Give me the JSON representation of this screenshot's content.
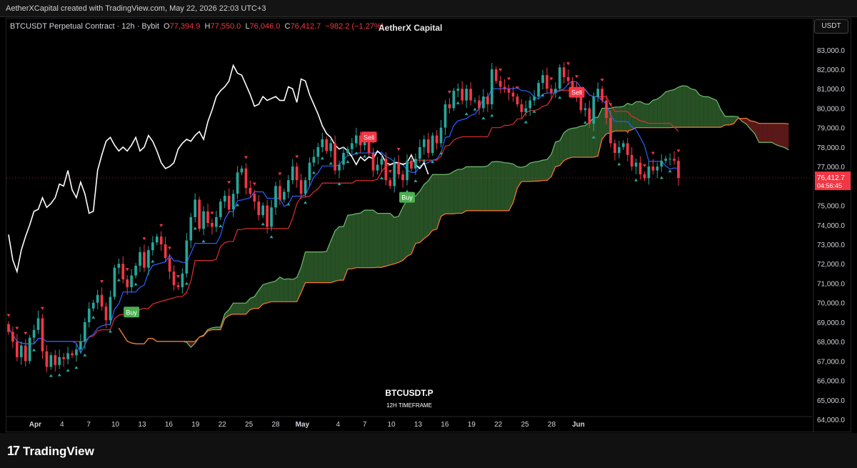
{
  "header": {
    "credit": "AetherXCapital created with TradingView.com, May 22, 2026 22:03 UTC+3"
  },
  "legend": {
    "symbol": "BTCUSDT Perpetual Contract · 12h · Bybit",
    "o_label": "O",
    "o_value": "77,394.9",
    "h_label": "H",
    "h_value": "77,550.0",
    "l_label": "L",
    "l_value": "76,046.0",
    "c_label": "C",
    "c_value": "76,412.7",
    "change": "−982.2 (−1.27%)"
  },
  "watermark_top": "AetherX Capital",
  "currency_button": "USDT",
  "footer_brand": "TradingView",
  "colors": {
    "up": "#26a69a",
    "down": "#f23645",
    "tenkan": "#2962ff",
    "kijun": "#e02e2e",
    "cloud_bull": "#2e5e2c",
    "cloud_bear": "#6b1c1c",
    "span_a": "#6fbf6f",
    "span_b": "#ff7a2f",
    "white_line": "#ffffff"
  },
  "chart_data": {
    "type": "candlestick",
    "title": "BTCUSDT.P",
    "subtitle": "12H TIMEFRAME",
    "ylim": [
      64000,
      83800
    ],
    "y_ticks": [
      "83,000.0",
      "82,000.0",
      "81,000.0",
      "80,000.0",
      "79,000.0",
      "78,000.0",
      "77,000.0",
      "76,000.0",
      "75,000.0",
      "74,000.0",
      "73,000.0",
      "72,000.0",
      "71,000.0",
      "70,000.0",
      "69,000.0",
      "68,000.0",
      "67,000.0",
      "66,000.0",
      "65,000.0",
      "64,000.0"
    ],
    "x_ticks": [
      "Apr",
      "4",
      "7",
      "10",
      "13",
      "16",
      "19",
      "22",
      "25",
      "28",
      "May",
      "4",
      "7",
      "10",
      "13",
      "16",
      "19",
      "22",
      "25",
      "28",
      "Jun"
    ],
    "last_price": "76,412.7",
    "countdown": "04:56:45",
    "signals": [
      {
        "label": "Buy",
        "type": "buy",
        "bar": 29,
        "price": 69500
      },
      {
        "label": "Sell",
        "type": "sell",
        "bar": 85,
        "price": 78500
      },
      {
        "label": "Buy",
        "type": "buy",
        "bar": 94,
        "price": 75400
      },
      {
        "label": "Sell",
        "type": "sell",
        "bar": 134,
        "price": 80800
      }
    ],
    "closes": [
      68500,
      68000,
      67200,
      67800,
      67000,
      68200,
      68600,
      69200,
      67500,
      66700,
      67300,
      66800,
      67200,
      67100,
      67400,
      67300,
      67600,
      68000,
      69000,
      69700,
      70000,
      70400,
      69800,
      69100,
      70300,
      71800,
      72000,
      71200,
      70800,
      71400,
      71900,
      72600,
      71800,
      72700,
      73100,
      73400,
      73000,
      72300,
      71600,
      70900,
      70800,
      71500,
      73200,
      74400,
      75300,
      73800,
      74700,
      74100,
      73900,
      74400,
      75200,
      75500,
      74800,
      75600,
      76700,
      76900,
      75900,
      75600,
      75200,
      74500,
      75000,
      73900,
      74900,
      76000,
      75300,
      75700,
      76300,
      77000,
      76300,
      75600,
      76300,
      77200,
      77500,
      78000,
      78400,
      77800,
      78200,
      76800,
      77100,
      77700,
      77900,
      78200,
      78600,
      78100,
      78400,
      77700,
      76800,
      77100,
      77400,
      76300,
      76000,
      77200,
      76600,
      76300,
      77300,
      76900,
      77400,
      78000,
      78400,
      77700,
      78600,
      78200,
      79000,
      80200,
      80000,
      80900,
      81000,
      80400,
      81000,
      80400,
      80400,
      80000,
      80600,
      80200,
      82000,
      81400,
      81100,
      81000,
      80800,
      80600,
      80200,
      79800,
      80000,
      80400,
      80600,
      81300,
      81700,
      81000,
      80800,
      81000,
      82100,
      81600,
      81400,
      81000,
      80600,
      79900,
      80000,
      79200,
      80600,
      81000,
      80400,
      79500,
      78200,
      77700,
      78000,
      78200,
      77600,
      77000,
      77200,
      76600,
      76400,
      77000,
      76800,
      77000,
      77300,
      77400,
      77400,
      77300,
      76400
    ],
    "white_line": [
      73500,
      72200,
      71600,
      72700,
      73400,
      74000,
      74700,
      74800,
      75400,
      74900,
      75100,
      75400,
      76100,
      76000,
      76800,
      75800,
      75400,
      76200,
      75600,
      74600,
      74700,
      76800,
      77600,
      78300,
      78500,
      78100,
      77800,
      78000,
      77800,
      78100,
      78500,
      77800,
      78000,
      78600,
      78300,
      77800,
      77200,
      76900,
      77000,
      77200,
      77900,
      78200,
      78400,
      78300,
      78600,
      78800,
      78400,
      79300,
      79900,
      80600,
      80900,
      81100,
      81400,
      82200,
      81800,
      81700,
      81200,
      80700,
      80100,
      80200,
      80600,
      80400,
      80500,
      80600,
      80400,
      80400,
      81100,
      81000,
      80300,
      81500,
      81400,
      80700,
      80200,
      79700,
      79100,
      78700,
      78500,
      78100,
      77900,
      78000,
      77800,
      77500,
      77100,
      77500,
      77300,
      77500,
      77400,
      77800,
      77600,
      77200,
      77100,
      77200,
      77200,
      77100,
      77200,
      77600,
      77100,
      76900,
      77200,
      76600
    ]
  }
}
